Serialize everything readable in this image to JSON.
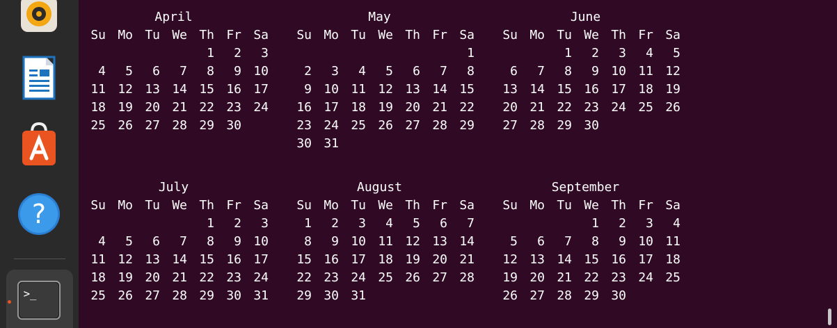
{
  "dock": {
    "apps": [
      {
        "name": "rhythmbox-icon"
      },
      {
        "name": "libreoffice-writer-icon"
      },
      {
        "name": "ubuntu-software-icon"
      },
      {
        "name": "help-icon"
      },
      {
        "name": "terminal-icon"
      }
    ],
    "terminal_glyph": ">_",
    "help_glyph": "?"
  },
  "calendar": {
    "months": [
      {
        "name": "April",
        "weekdays": [
          "Su",
          "Mo",
          "Tu",
          "We",
          "Th",
          "Fr",
          "Sa"
        ],
        "weeks": [
          [
            "",
            "",
            "",
            "",
            "1",
            "2",
            "3"
          ],
          [
            "4",
            "5",
            "6",
            "7",
            "8",
            "9",
            "10"
          ],
          [
            "11",
            "12",
            "13",
            "14",
            "15",
            "16",
            "17"
          ],
          [
            "18",
            "19",
            "20",
            "21",
            "22",
            "23",
            "24"
          ],
          [
            "25",
            "26",
            "27",
            "28",
            "29",
            "30",
            ""
          ],
          [
            "",
            "",
            "",
            "",
            "",
            "",
            ""
          ]
        ]
      },
      {
        "name": "May",
        "weekdays": [
          "Su",
          "Mo",
          "Tu",
          "We",
          "Th",
          "Fr",
          "Sa"
        ],
        "weeks": [
          [
            "",
            "",
            "",
            "",
            "",
            "",
            "1"
          ],
          [
            "2",
            "3",
            "4",
            "5",
            "6",
            "7",
            "8"
          ],
          [
            "9",
            "10",
            "11",
            "12",
            "13",
            "14",
            "15"
          ],
          [
            "16",
            "17",
            "18",
            "19",
            "20",
            "21",
            "22"
          ],
          [
            "23",
            "24",
            "25",
            "26",
            "27",
            "28",
            "29"
          ],
          [
            "30",
            "31",
            "",
            "",
            "",
            "",
            ""
          ]
        ]
      },
      {
        "name": "June",
        "weekdays": [
          "Su",
          "Mo",
          "Tu",
          "We",
          "Th",
          "Fr",
          "Sa"
        ],
        "weeks": [
          [
            "",
            "",
            "1",
            "2",
            "3",
            "4",
            "5"
          ],
          [
            "6",
            "7",
            "8",
            "9",
            "10",
            "11",
            "12"
          ],
          [
            "13",
            "14",
            "15",
            "16",
            "17",
            "18",
            "19"
          ],
          [
            "20",
            "21",
            "22",
            "23",
            "24",
            "25",
            "26"
          ],
          [
            "27",
            "28",
            "29",
            "30",
            "",
            "",
            ""
          ],
          [
            "",
            "",
            "",
            "",
            "",
            "",
            ""
          ]
        ]
      },
      {
        "name": "July",
        "weekdays": [
          "Su",
          "Mo",
          "Tu",
          "We",
          "Th",
          "Fr",
          "Sa"
        ],
        "weeks": [
          [
            "",
            "",
            "",
            "",
            "1",
            "2",
            "3"
          ],
          [
            "4",
            "5",
            "6",
            "7",
            "8",
            "9",
            "10"
          ],
          [
            "11",
            "12",
            "13",
            "14",
            "15",
            "16",
            "17"
          ],
          [
            "18",
            "19",
            "20",
            "21",
            "22",
            "23",
            "24"
          ],
          [
            "25",
            "26",
            "27",
            "28",
            "29",
            "30",
            "31"
          ],
          [
            "",
            "",
            "",
            "",
            "",
            "",
            ""
          ]
        ]
      },
      {
        "name": "August",
        "weekdays": [
          "Su",
          "Mo",
          "Tu",
          "We",
          "Th",
          "Fr",
          "Sa"
        ],
        "weeks": [
          [
            "1",
            "2",
            "3",
            "4",
            "5",
            "6",
            "7"
          ],
          [
            "8",
            "9",
            "10",
            "11",
            "12",
            "13",
            "14"
          ],
          [
            "15",
            "16",
            "17",
            "18",
            "19",
            "20",
            "21"
          ],
          [
            "22",
            "23",
            "24",
            "25",
            "26",
            "27",
            "28"
          ],
          [
            "29",
            "30",
            "31",
            "",
            "",
            "",
            ""
          ],
          [
            "",
            "",
            "",
            "",
            "",
            "",
            ""
          ]
        ]
      },
      {
        "name": "September",
        "weekdays": [
          "Su",
          "Mo",
          "Tu",
          "We",
          "Th",
          "Fr",
          "Sa"
        ],
        "weeks": [
          [
            "",
            "",
            "",
            "1",
            "2",
            "3",
            "4"
          ],
          [
            "5",
            "6",
            "7",
            "8",
            "9",
            "10",
            "11"
          ],
          [
            "12",
            "13",
            "14",
            "15",
            "16",
            "17",
            "18"
          ],
          [
            "19",
            "20",
            "21",
            "22",
            "23",
            "24",
            "25"
          ],
          [
            "26",
            "27",
            "28",
            "29",
            "30",
            "",
            ""
          ],
          [
            "",
            "",
            "",
            "",
            "",
            "",
            ""
          ]
        ]
      }
    ]
  },
  "colors": {
    "terminal_bg": "#300a24",
    "text": "#ffffff",
    "accent": "#e95420"
  }
}
